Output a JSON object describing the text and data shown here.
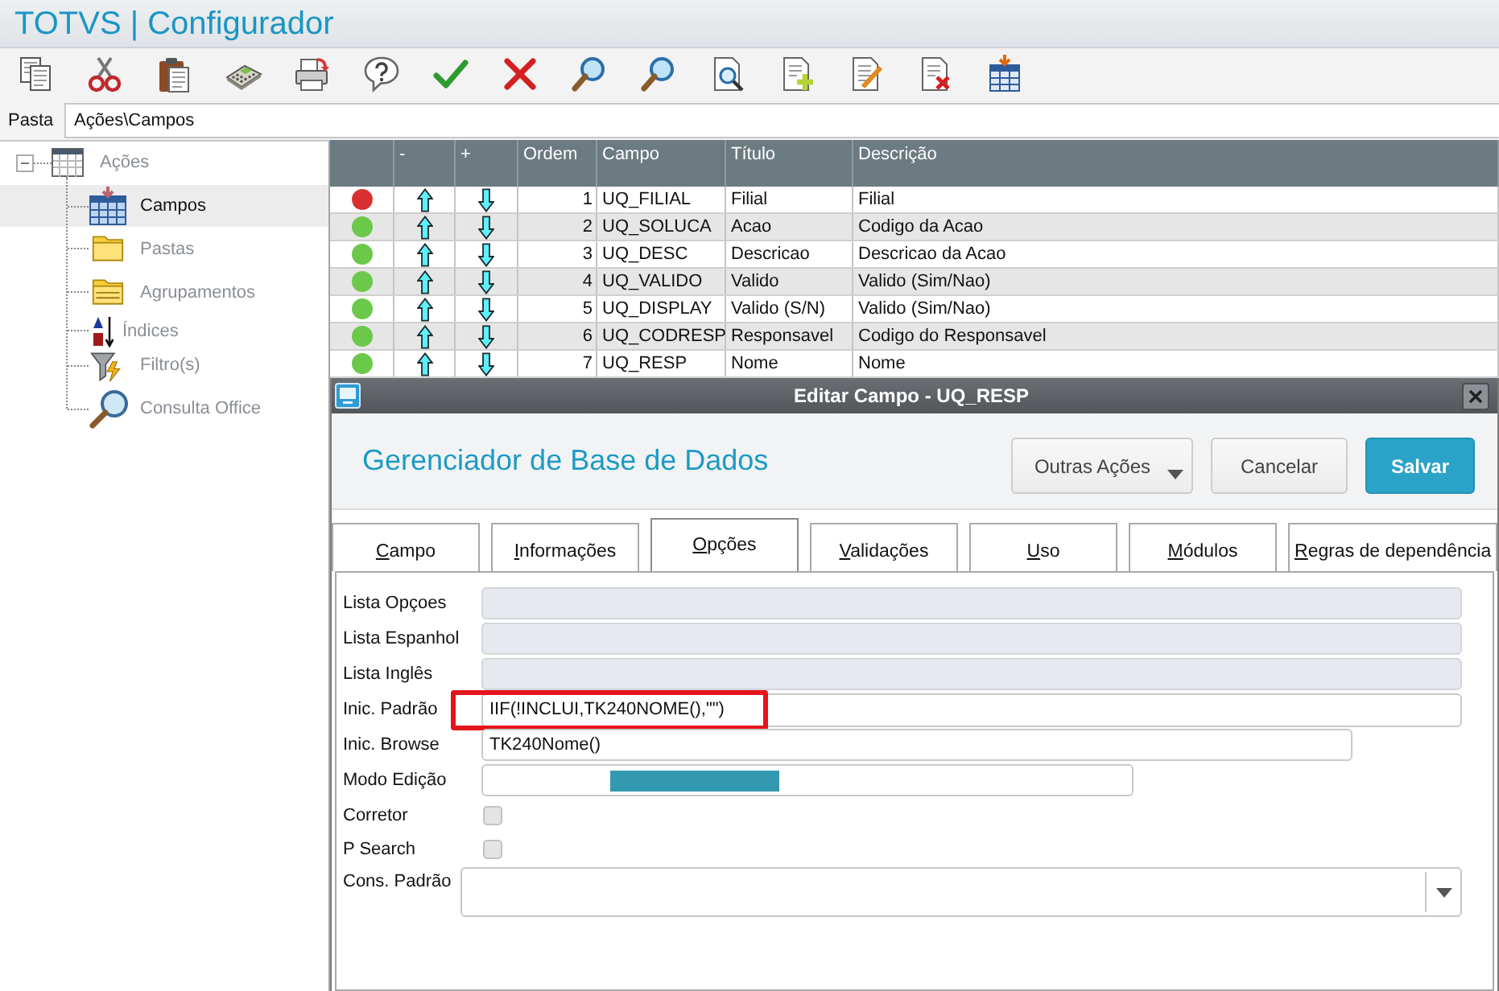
{
  "window": {
    "title": "TOTVS | Configurador"
  },
  "path_bar": {
    "label": "Pasta",
    "value": "Ações\\Campos"
  },
  "sidebar": {
    "tree": [
      {
        "label": "Ações",
        "selected": false,
        "expanded": true,
        "children": [
          {
            "label": "Campos",
            "selected": true
          },
          {
            "label": "Pastas",
            "selected": false
          },
          {
            "label": "Agrupamentos",
            "selected": false
          },
          {
            "label": "Índices",
            "selected": false
          },
          {
            "label": "Filtro(s)",
            "selected": false
          },
          {
            "label": "Consulta Office",
            "selected": false
          }
        ]
      }
    ]
  },
  "table": {
    "columns": [
      "-",
      "+",
      "Ordem",
      "Campo",
      "Título",
      "Descrição"
    ],
    "rows": [
      {
        "color": "#d83030",
        "order": "1",
        "field": "UQ_FILIAL",
        "title": "Filial",
        "description": "Filial"
      },
      {
        "color": "#6cc84a",
        "order": "2",
        "field": "UQ_SOLUCA",
        "title": "Acao",
        "description": "Codigo da Acao"
      },
      {
        "color": "#6cc84a",
        "order": "3",
        "field": "UQ_DESC",
        "title": "Descricao",
        "description": "Descricao da Acao"
      },
      {
        "color": "#6cc84a",
        "order": "4",
        "field": "UQ_VALIDO",
        "title": "Valido",
        "description": "Valido (Sim/Nao)"
      },
      {
        "color": "#6cc84a",
        "order": "5",
        "field": "UQ_DISPLAY",
        "title": "Valido (S/N)",
        "description": "Valido (Sim/Nao)"
      },
      {
        "color": "#6cc84a",
        "order": "6",
        "field": "UQ_CODRESP",
        "title": "Responsavel",
        "description": "Codigo do Responsavel"
      },
      {
        "color": "#6cc84a",
        "order": "7",
        "field": "UQ_RESP",
        "title": "Nome",
        "description": "Nome"
      }
    ]
  },
  "dialog": {
    "title": "Editar Campo - UQ_RESP",
    "heading": "Gerenciador de Base de Dados",
    "buttons": [
      {
        "label": "Outras Ações",
        "kind": "menu"
      },
      {
        "label": "Cancelar",
        "kind": "default"
      },
      {
        "label": "Salvar",
        "kind": "primary"
      }
    ],
    "tabs": [
      {
        "label": "Campo",
        "selected": false
      },
      {
        "label": "Informações",
        "selected": false
      },
      {
        "label": "Opções",
        "selected": true
      },
      {
        "label": "Validações",
        "selected": false
      },
      {
        "label": "Uso",
        "selected": false
      },
      {
        "label": "Módulos",
        "selected": false
      },
      {
        "label": "Regras de dependência",
        "selected": false
      }
    ],
    "fields": [
      {
        "label": "Lista Opçoes",
        "kind": "text",
        "disabled": true,
        "marked": false
      },
      {
        "label": "Lista Espanhol",
        "kind": "text",
        "disabled": true,
        "marked": false
      },
      {
        "label": "Lista Inglês",
        "kind": "text",
        "disabled": true,
        "marked": false
      },
      {
        "label": "Inic. Padrão",
        "kind": "text",
        "disabled": false,
        "marked": true,
        "value": "IIF(!INCLUI,TK240NOME(),\"\")"
      },
      {
        "label": "Inic. Browse",
        "kind": "text",
        "disabled": false,
        "marked": false,
        "value": "TK240Nome()"
      },
      {
        "label": "Modo Edição",
        "kind": "highlight"
      },
      {
        "label": "Corretor",
        "kind": "check",
        "checked": false
      },
      {
        "label": "P Search",
        "kind": "check",
        "checked": false
      },
      {
        "label": "Cons. Padrão",
        "kind": "combo"
      }
    ]
  }
}
